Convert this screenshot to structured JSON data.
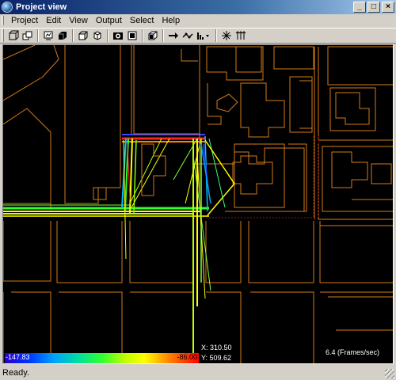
{
  "window": {
    "title": "Project view",
    "minimize": "_",
    "maximize": "□",
    "close": "×"
  },
  "menu": [
    "Project",
    "Edit",
    "View",
    "Output",
    "Select",
    "Help"
  ],
  "toolbar": {
    "buttons": [
      {
        "icon": "box-outline-icon"
      },
      {
        "icon": "box-stack-icon"
      },
      {
        "icon": "image-frame-icon"
      },
      {
        "icon": "solid-box-icon"
      },
      {
        "icon": "cube-outline-icon"
      },
      {
        "icon": "cube-side-icon"
      },
      {
        "icon": "camera-icon"
      },
      {
        "icon": "render-icon"
      },
      {
        "icon": "layer-box-icon"
      },
      {
        "icon": "arrow-right-icon"
      },
      {
        "icon": "route-icon"
      },
      {
        "icon": "histogram-dropdown-icon"
      },
      {
        "icon": "antenna-star-icon"
      },
      {
        "icon": "antenna-array-icon"
      }
    ]
  },
  "legend": {
    "min": "-147.83",
    "max": "-86.00"
  },
  "coords": {
    "x": "X: 310.50",
    "y": "Y: 509.62"
  },
  "fps": "6.4 (Frames/sec)",
  "status": "Ready.",
  "colors": {
    "building": "#d47a1a",
    "background": "#000000",
    "ray_strong": "#ff2020",
    "ray_weak": "#2020ff"
  }
}
